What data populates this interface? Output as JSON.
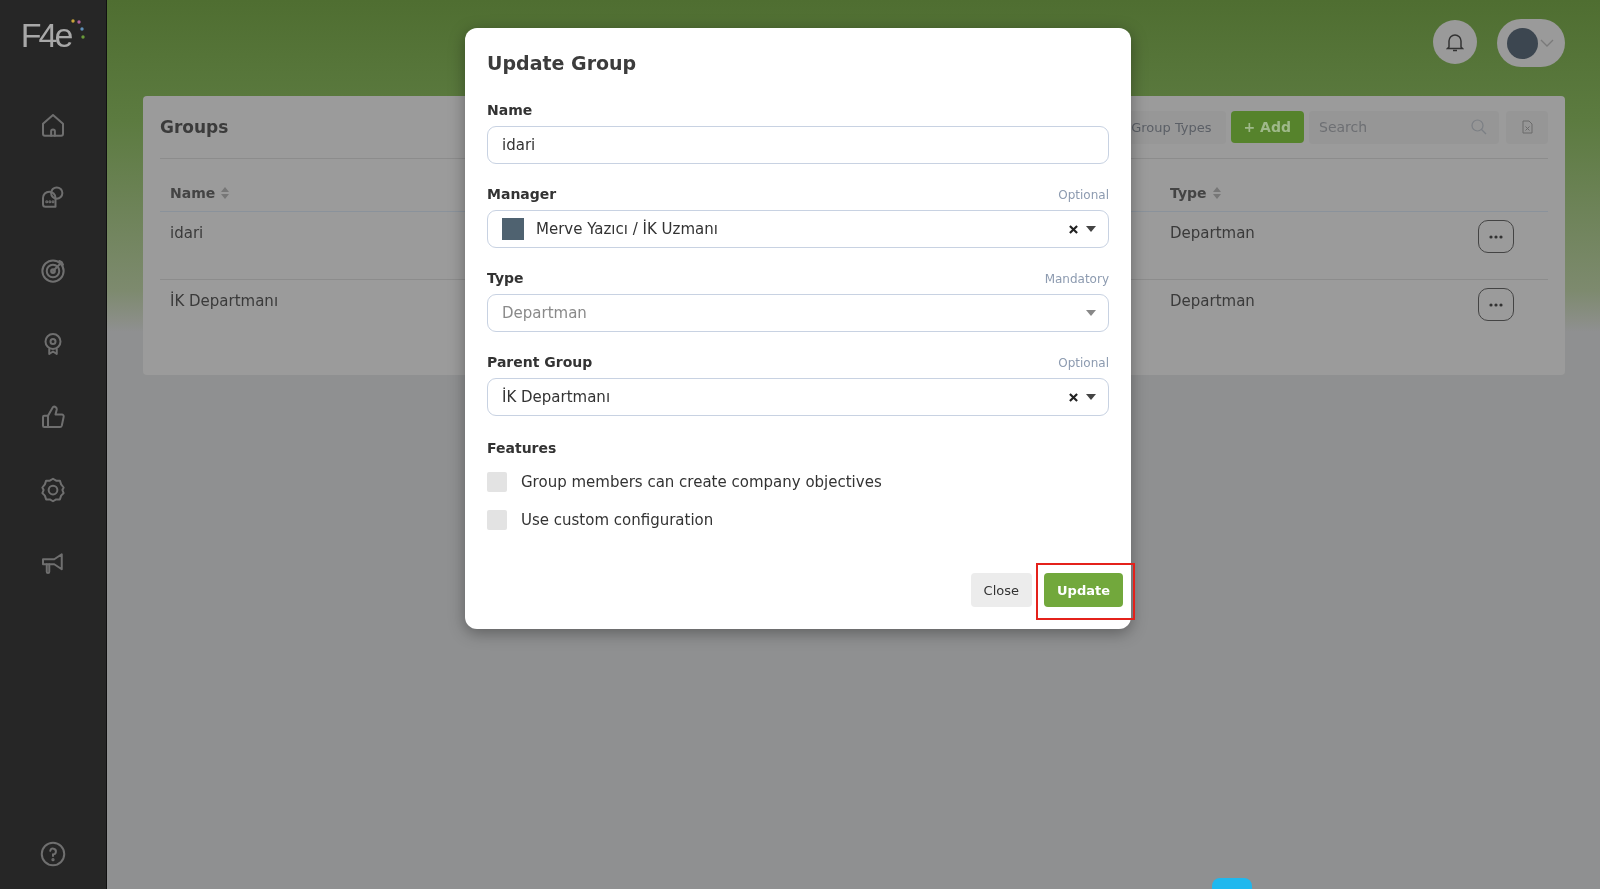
{
  "sidebar": {
    "logo": "F4e"
  },
  "groups_card": {
    "title": "Groups",
    "toolbar": {
      "group_types": "Group Types",
      "add": "+ Add",
      "search_placeholder": "Search"
    },
    "table": {
      "columns": [
        "Name",
        "Type"
      ],
      "rows": [
        {
          "name": "idari",
          "type": "Departman"
        },
        {
          "name": "İK Departmanı",
          "type": "Departman"
        }
      ]
    }
  },
  "modal": {
    "title": "Update Group",
    "fields": [
      {
        "kind": "text",
        "label": "Name",
        "value": "idari"
      },
      {
        "kind": "person-select",
        "label": "Manager",
        "hint": "Optional",
        "value": "Merve Yazıcı / İK Uzmanı",
        "disabled": false,
        "clearable": true
      },
      {
        "kind": "select",
        "label": "Type",
        "hint": "Mandatory",
        "value": "Departman",
        "disabled": true,
        "clearable": false
      },
      {
        "kind": "select",
        "label": "Parent Group",
        "hint": "Optional",
        "value": "İK Departmanı",
        "disabled": false,
        "clearable": true
      }
    ],
    "features": {
      "label": "Features",
      "options": [
        {
          "label": "Group members can create company objectives",
          "checked": false
        },
        {
          "label": "Use custom configuration",
          "checked": false
        }
      ]
    },
    "buttons": [
      {
        "kind": "secondary",
        "label": "Close",
        "highlighted": false
      },
      {
        "kind": "primary",
        "label": "Update",
        "highlighted": true
      }
    ]
  }
}
